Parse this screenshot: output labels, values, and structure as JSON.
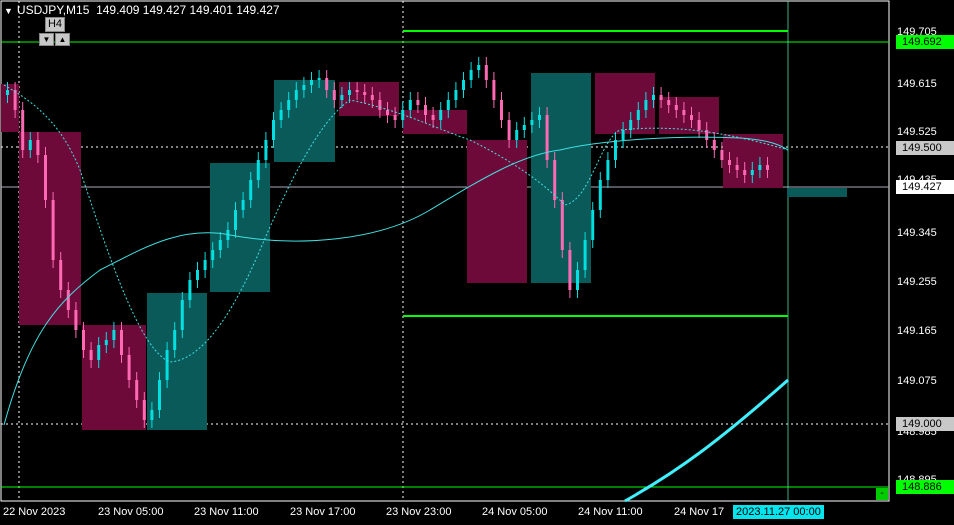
{
  "header": {
    "symbol": "USDJPY,M15",
    "ohlc": "149.409 149.427 149.401 149.427",
    "overlay_timeframe": "H4"
  },
  "price_scale": [
    "149.705",
    "149.615",
    "149.525",
    "149.435",
    "149.345",
    "149.255",
    "149.165",
    "149.075",
    "148.985",
    "148.895"
  ],
  "price_labels": {
    "upper_level": "149.692",
    "dotted_level": "149.500",
    "current": "149.427",
    "dotted_low": "149.000",
    "lower_level": "148.886"
  },
  "time_scale": [
    "22 Nov 2023",
    "23 Nov 05:00",
    "23 Nov 11:00",
    "23 Nov 17:00",
    "23 Nov 23:00",
    "24 Nov 05:00",
    "24 Nov 11:00",
    "24 Nov 17"
  ],
  "crosshair_time": "2023.11.27 00:00",
  "colors": {
    "bull_candle": "#00e0e0",
    "bear_candle": "#ff69b4",
    "h4_bull_box": "#0a5a5a",
    "h4_bear_box": "#6e0a3a",
    "level_line": "#00ff00",
    "ma": "#40e0e0"
  }
}
